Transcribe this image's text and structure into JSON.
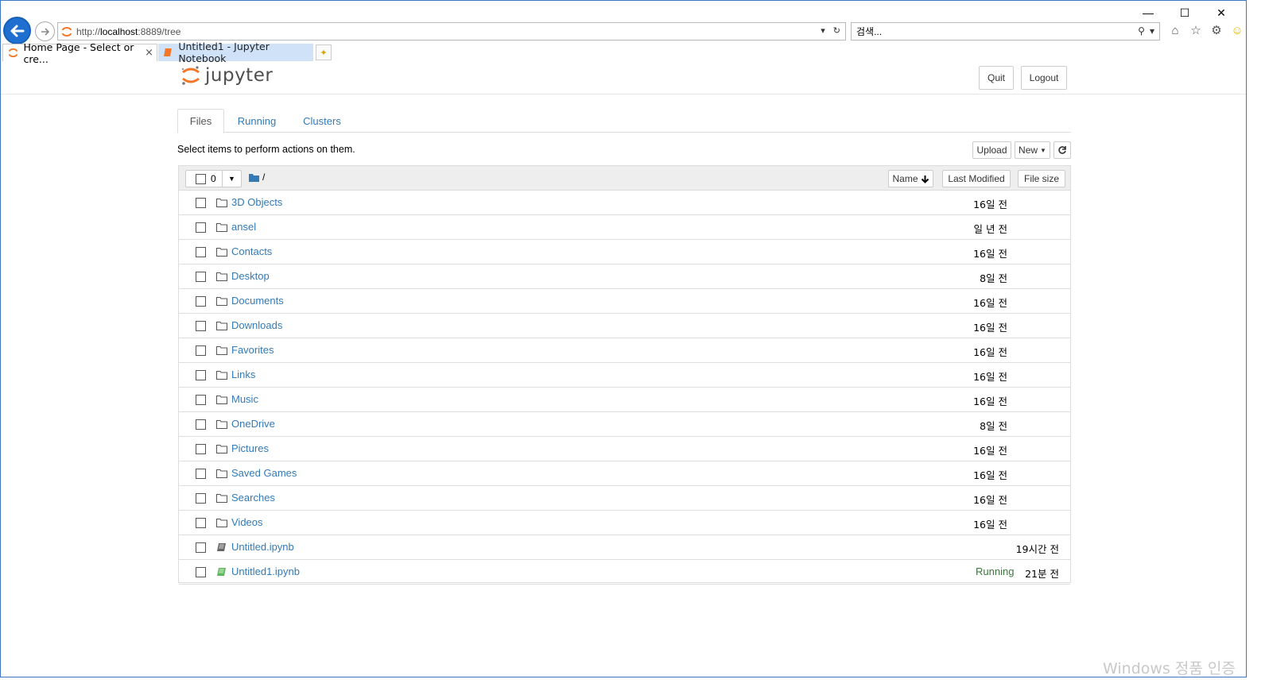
{
  "browser": {
    "url_prefix": "http://",
    "url_host": "localhost",
    "url_rest": ":8889/tree",
    "search_placeholder": "검색...",
    "tabs": [
      {
        "label": "Home Page - Select or cre...",
        "close": "×"
      },
      {
        "label": "Untitled1 - Jupyter Notebook"
      }
    ],
    "window_controls": {
      "minimize": "—",
      "maximize": "☐",
      "close": "✕"
    }
  },
  "header": {
    "logo_text": "jupyter",
    "quit_label": "Quit",
    "logout_label": "Logout"
  },
  "nav_tabs": [
    "Files",
    "Running",
    "Clusters"
  ],
  "toolbar": {
    "instructions": "Select items to perform actions on them.",
    "upload_label": "Upload",
    "new_label": "New"
  },
  "list_header": {
    "selected_count": "0",
    "breadcrumb": "/",
    "name_label": "Name",
    "modified_label": "Last Modified",
    "size_label": "File size"
  },
  "items": [
    {
      "name": "3D Objects",
      "type": "folder",
      "modified": "16일 전"
    },
    {
      "name": "ansel",
      "type": "folder",
      "modified": "일 년 전"
    },
    {
      "name": "Contacts",
      "type": "folder",
      "modified": "16일 전"
    },
    {
      "name": "Desktop",
      "type": "folder",
      "modified": "8일 전"
    },
    {
      "name": "Documents",
      "type": "folder",
      "modified": "16일 전"
    },
    {
      "name": "Downloads",
      "type": "folder",
      "modified": "16일 전"
    },
    {
      "name": "Favorites",
      "type": "folder",
      "modified": "16일 전"
    },
    {
      "name": "Links",
      "type": "folder",
      "modified": "16일 전"
    },
    {
      "name": "Music",
      "type": "folder",
      "modified": "16일 전"
    },
    {
      "name": "OneDrive",
      "type": "folder",
      "modified": "8일 전"
    },
    {
      "name": "Pictures",
      "type": "folder",
      "modified": "16일 전"
    },
    {
      "name": "Saved Games",
      "type": "folder",
      "modified": "16일 전"
    },
    {
      "name": "Searches",
      "type": "folder",
      "modified": "16일 전"
    },
    {
      "name": "Videos",
      "type": "folder",
      "modified": "16일 전"
    },
    {
      "name": "Untitled.ipynb",
      "type": "notebook",
      "modified": "19시간 전"
    },
    {
      "name": "Untitled1.ipynb",
      "type": "notebook-running",
      "modified": "21분 전",
      "status": "Running"
    }
  ],
  "watermark": "Windows 정품 인증",
  "colors": {
    "link": "#337ab7",
    "running": "#3c763d",
    "ie_blue": "#1e6fd0",
    "jupyter_orange": "#f37726"
  }
}
